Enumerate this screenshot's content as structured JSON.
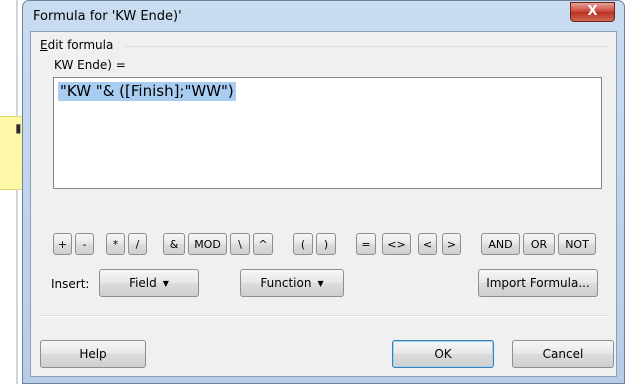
{
  "background": {
    "quote_glyph": "''"
  },
  "dialog": {
    "title": "Formula for 'KW Ende)'",
    "close_glyph": "X",
    "edit_formula_group": "Edit formula",
    "field_label": "KW Ende) =",
    "formula_text": "\"KW \"& ([Finish];\"WW\")",
    "operators": [
      "+",
      "-",
      "*",
      "/",
      "&",
      "MOD",
      "\\",
      "^",
      "(",
      ")",
      "=",
      "<>",
      "<",
      ">",
      "AND",
      "OR",
      "NOT"
    ],
    "insert_label": "Insert:",
    "field_button": "Field",
    "function_button": "Function",
    "import_button": "Import Formula...",
    "dropdown_caret": "▼",
    "help_button": "Help",
    "ok_button": "OK",
    "cancel_button": "Cancel"
  },
  "colors": {
    "selection": "#a9cdf0",
    "window_frame": "#c9dcf0",
    "close_red": "#c8473a",
    "note_yellow": "#fdf7a8"
  }
}
